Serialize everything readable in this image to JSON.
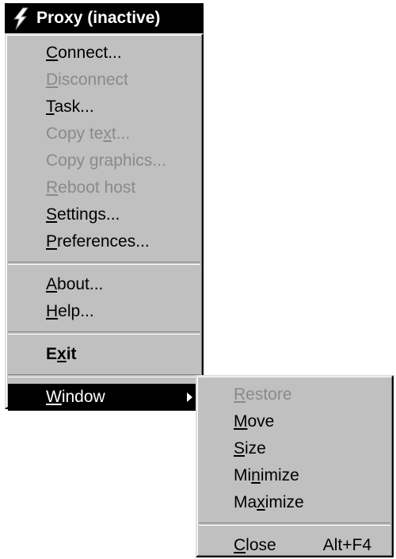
{
  "window": {
    "title": "Proxy (inactive)",
    "icon": "lightning-bolt-icon"
  },
  "main_menu": {
    "items": [
      {
        "label": "Connect...",
        "mnemonic": "C",
        "enabled": true
      },
      {
        "label": "Disconnect",
        "mnemonic": "D",
        "enabled": false
      },
      {
        "label": "Task...",
        "mnemonic": "T",
        "enabled": true
      },
      {
        "label": "Copy text...",
        "mnemonic": "x",
        "enabled": false
      },
      {
        "label": "Copy graphics...",
        "mnemonic": "g",
        "enabled": false
      },
      {
        "label": "Reboot host",
        "mnemonic": "R",
        "enabled": false
      },
      {
        "label": "Settings...",
        "mnemonic": "S",
        "enabled": true
      },
      {
        "label": "Preferences...",
        "mnemonic": "P",
        "enabled": true
      },
      {
        "label": "About...",
        "mnemonic": "A",
        "enabled": true
      },
      {
        "label": "Help...",
        "mnemonic": "H",
        "enabled": true
      },
      {
        "label": "Exit",
        "mnemonic": "x",
        "enabled": true,
        "bold": true
      },
      {
        "label": "Window",
        "mnemonic": "W",
        "enabled": true,
        "selected": true,
        "has_submenu": true
      }
    ]
  },
  "window_submenu": {
    "items": [
      {
        "label": "Restore",
        "mnemonic": "R",
        "enabled": false
      },
      {
        "label": "Move",
        "mnemonic": "M",
        "enabled": true
      },
      {
        "label": "Size",
        "mnemonic": "S",
        "enabled": true
      },
      {
        "label": "Minimize",
        "mnemonic": "n",
        "enabled": true
      },
      {
        "label": "Maximize",
        "mnemonic": "x",
        "enabled": true
      },
      {
        "label": "Close",
        "mnemonic": "C",
        "enabled": true,
        "shortcut": "Alt+F4"
      }
    ]
  },
  "colors": {
    "menu_face": "#c0c0c0",
    "highlight": "#000000",
    "disabled_text": "#8a8a8a",
    "title_bar": "#000000"
  }
}
